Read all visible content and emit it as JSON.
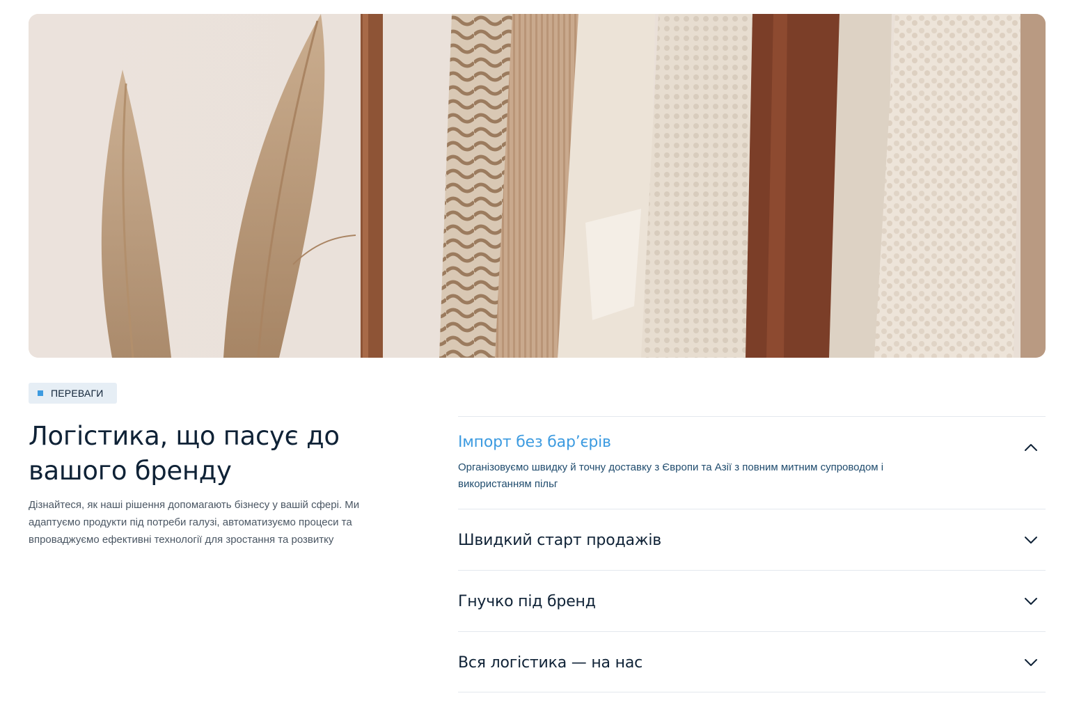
{
  "hero": {
    "image_description": "hero-image"
  },
  "section": {
    "tag_label": "ПЕРЕВАГИ",
    "title": "Логістика, що пасує до вашого бренду",
    "description": "Дізнайтеся, як наші рішення допомагають бізнесу у вашій сфері. Ми адаптуємо продукти під потреби галузі, автоматизуємо процеси та впроваджуємо ефективні технології для зростання та розвитку"
  },
  "accordion": {
    "items": [
      {
        "title": "Імпорт без бар’єрів",
        "body": "Організовуємо швидку й точну доставку з Європи та Азії з повним митним супроводом і використанням пільг",
        "expanded": true
      },
      {
        "title": "Швидкий старт продажів",
        "expanded": false
      },
      {
        "title": "Гнучко під бренд",
        "expanded": false
      },
      {
        "title": "Вся логістика — на нас",
        "expanded": false
      }
    ]
  },
  "colors": {
    "accent": "#3d9be0",
    "text_dark": "#0f2236",
    "tag_bg": "#e6eef5",
    "divider": "#e3e8ee"
  }
}
